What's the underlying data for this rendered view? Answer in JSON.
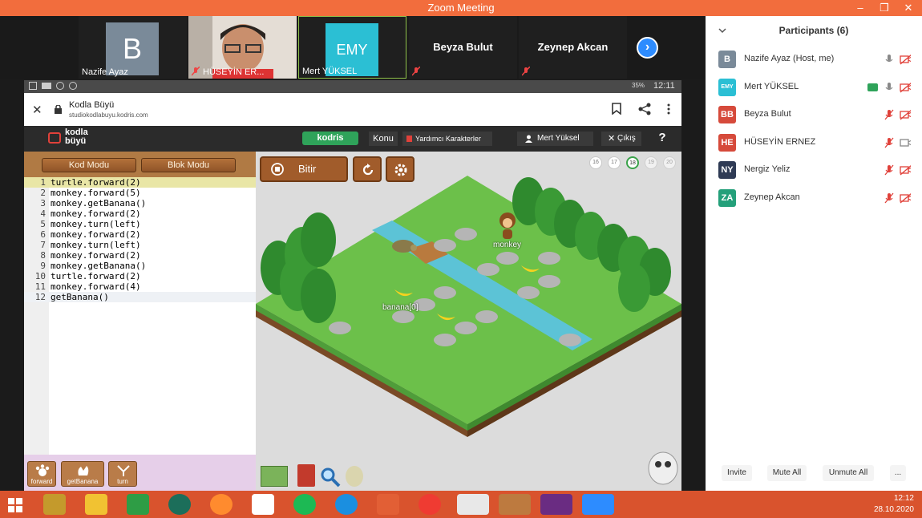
{
  "window": {
    "title": "Zoom Meeting",
    "minimize": "–",
    "restore": "❐",
    "close": "✕"
  },
  "video_strip": [
    {
      "kind": "avatar",
      "letter": "B",
      "name": "Nazife Ayaz",
      "color": "#7a8a99"
    },
    {
      "kind": "photo",
      "name": "HÜSEYİN ER..."
    },
    {
      "kind": "avatar",
      "letter": "EMY",
      "name": "Mert YÜKSEL",
      "color": "#2bbfd4"
    },
    {
      "kind": "name",
      "name": "Beyza Bulut"
    },
    {
      "kind": "name",
      "name": "Zeynep Akcan"
    }
  ],
  "next_arrow": "›",
  "phone_status": {
    "battery": "35%",
    "time": "12:11"
  },
  "browser": {
    "title": "Kodla Büyü",
    "url": "studiokodlabuyu.kodris.com",
    "close": "✕"
  },
  "app": {
    "logo_line1": "kodla",
    "logo_line2": "büyü",
    "brand": "kodris",
    "menu_topic": "Konu",
    "menu_helpers": "Yardımcı Karakterler",
    "user": "Mert Yüksel",
    "logout": "Çıkış",
    "help": "?"
  },
  "editor": {
    "mode_code": "Kod Modu",
    "mode_block": "Blok Modu",
    "lines": [
      {
        "n": "1",
        "text": "turtle.forward(2)"
      },
      {
        "n": "2",
        "text": "monkey.forward(5)"
      },
      {
        "n": "3",
        "text": "monkey.getBanana()"
      },
      {
        "n": "4",
        "text": "monkey.forward(2)"
      },
      {
        "n": "5",
        "text": "monkey.turn(left)"
      },
      {
        "n": "6",
        "text": "monkey.forward(2)"
      },
      {
        "n": "7",
        "text": "monkey.turn(left)"
      },
      {
        "n": "8",
        "text": "monkey.forward(2)"
      },
      {
        "n": "9",
        "text": "monkey.getBanana()"
      },
      {
        "n": "10",
        "text": "turtle.forward(2)"
      },
      {
        "n": "11",
        "text": "monkey.forward(4)"
      },
      {
        "n": "12",
        "text": "getBanana()"
      }
    ],
    "blocks": [
      "forward",
      "getBanana",
      "turn"
    ]
  },
  "game": {
    "stop_label": "Bitir",
    "levels": [
      "16",
      "17",
      "18",
      "19",
      "20"
    ],
    "active_level": "18",
    "monkey_label": "monkey",
    "banana_label": "banana[0]"
  },
  "participants": {
    "header": "Participants (6)",
    "list": [
      {
        "initials": "B",
        "name": "Nazife Ayaz (Host, me)",
        "color": "#7a8a99"
      },
      {
        "initials": "EMY",
        "name": "Mert YÜKSEL",
        "color": "#2bbfd4"
      },
      {
        "initials": "BB",
        "name": "Beyza Bulut",
        "color": "#d64a3b"
      },
      {
        "initials": "HE",
        "name": "HÜSEYİN ERNEZ",
        "color": "#d64a3b"
      },
      {
        "initials": "NY",
        "name": "Nergiz Yeliz",
        "color": "#2f3b55"
      },
      {
        "initials": "ZA",
        "name": "Zeynep Akcan",
        "color": "#24a07a"
      }
    ],
    "invite": "Invite",
    "mute_all": "Mute All",
    "unmute_all": "Unmute All",
    "more": "..."
  },
  "taskbar": {
    "time": "12:12",
    "date": "28.10.2020"
  }
}
